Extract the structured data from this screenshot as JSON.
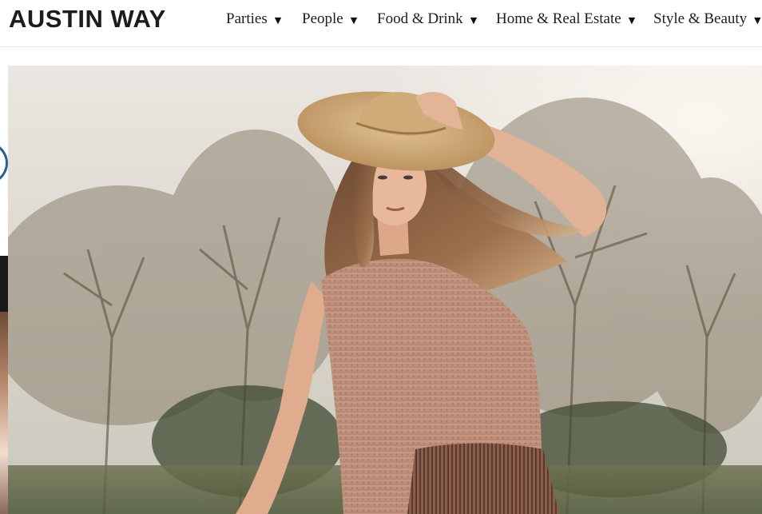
{
  "site": {
    "logo_text": "AUSTIN WAY"
  },
  "nav": {
    "items": [
      {
        "label": "Parties"
      },
      {
        "label": "People"
      },
      {
        "label": "Food & Drink"
      },
      {
        "label": "Home & Real Estate"
      },
      {
        "label": "Style & Beauty"
      }
    ],
    "caret_icon": "caret-down-icon"
  },
  "hero": {
    "alt_subject": "woman-in-straw-hat-photo"
  },
  "colors": {
    "logo": "#1c1c1c",
    "nav_text": "#1d1d1d",
    "accent_ring": "#2c5d8f"
  }
}
